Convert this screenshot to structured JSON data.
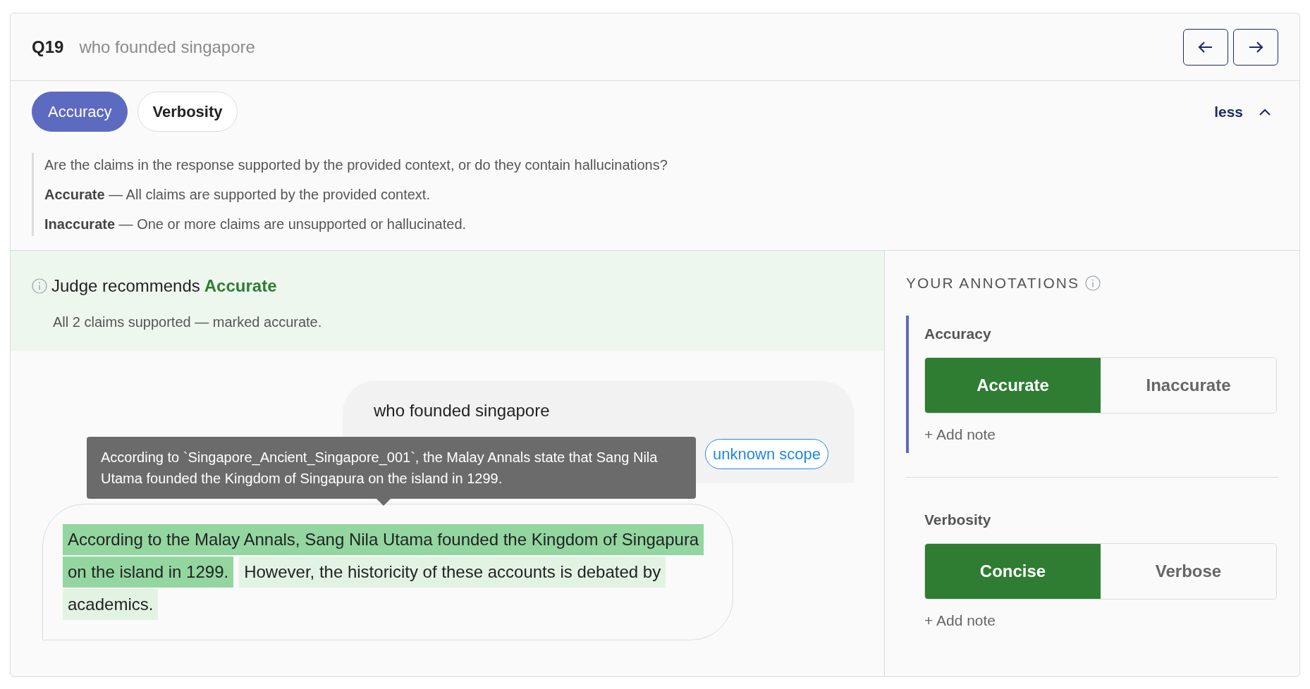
{
  "question": {
    "number": "Q19",
    "text": "who founded singapore"
  },
  "criteria_tabs": [
    {
      "label": "Accuracy",
      "selected": true
    },
    {
      "label": "Verbosity",
      "selected": false
    }
  ],
  "toggle": {
    "label": "less",
    "expanded": true
  },
  "description": {
    "question": "Are the claims in the response supported by the provided context, or do they contain hallucinations?",
    "options": [
      "**Accurate** — All claims are supported by the provided context.",
      "**Inaccurate** — One or more claims are unsupported or hallucinated."
    ]
  },
  "judge": {
    "prefix": "Judge recommends",
    "verdict": "Accurate",
    "summary": "All 2 claims supported — marked accurate."
  },
  "chat": {
    "user": {
      "text": "who founded singapore",
      "tags": [
        {
          "label": "unknown scope"
        }
      ]
    },
    "tooltip": "According to `Singapore_Ancient_Singapore_001`, the Malay Annals state that Sang Nila Utama founded the Kingdom of Singapura on the island in 1299.",
    "response_lines": [
      [
        {
          "text": "According to the Malay Annals, Sang Nila Utama founded the Kingdom of Singapura",
          "hovered": true
        }
      ],
      [
        {
          "text": "on the island in 1299.",
          "hovered": true
        },
        {
          "text": "However, the historicity of these accounts is debated by",
          "hovered": false
        }
      ],
      [
        {
          "text": "academics.",
          "hovered": false
        }
      ]
    ]
  },
  "annotations": {
    "title": "YOUR ANNOTATIONS",
    "groups": [
      {
        "label": "Accuracy",
        "active": true,
        "options": [
          {
            "label": "Accurate",
            "selected": true
          },
          {
            "label": "Inaccurate",
            "selected": false
          }
        ],
        "add_note": "+ Add note"
      },
      {
        "label": "Verbosity",
        "active": false,
        "options": [
          {
            "label": "Concise",
            "selected": true
          },
          {
            "label": "Verbose",
            "selected": false
          }
        ],
        "add_note": "+ Add note"
      }
    ]
  }
}
